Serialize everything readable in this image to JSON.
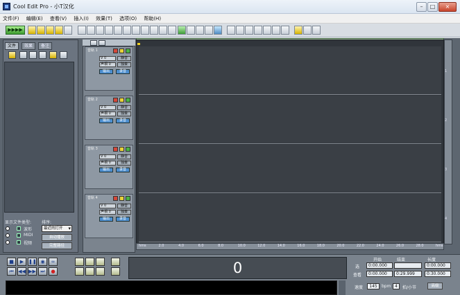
{
  "window": {
    "title": "Cool Edit Pro  - 小T汉化",
    "min": "–",
    "max": "□",
    "close": "×"
  },
  "menu": [
    "文件(F)",
    "编辑(E)",
    "查看(V)",
    "插入(I)",
    "效果(T)",
    "选项(O)",
    "帮助(H)"
  ],
  "toolbar": {
    "mode_label": "▶▶▶▶"
  },
  "left_panel": {
    "tabs": [
      "文件",
      "效果",
      "备注"
    ],
    "show_type_label": "显示文件类型:",
    "sort_label": "排序:",
    "types": [
      "波形",
      "MIDI",
      "视频"
    ],
    "sort_value": "最近的打开",
    "btn1": "自动播放",
    "btn2": "完整路径"
  },
  "tracks": [
    {
      "name": "音轨 1",
      "vol": "V 0",
      "pan": "声相 0",
      "b1": "静音",
      "b2": "独奏",
      "out": "输出",
      "rec": "录音"
    },
    {
      "name": "音轨 2",
      "vol": "V 0",
      "pan": "声相 0",
      "b1": "静音",
      "b2": "独奏",
      "out": "输出",
      "rec": "录音"
    },
    {
      "name": "音轨 3",
      "vol": "V 0",
      "pan": "声相 0",
      "b1": "静音",
      "b2": "独奏",
      "out": "输出",
      "rec": "录音"
    },
    {
      "name": "音轨 4",
      "vol": "V 0",
      "pan": "声相 0",
      "b1": "静音",
      "b2": "独奏",
      "out": "输出",
      "rec": "录音"
    }
  ],
  "lane_numbers": [
    "1",
    "2",
    "3",
    "4"
  ],
  "timeline": [
    "hms",
    "2.0",
    "4.0",
    "6.0",
    "8.0",
    "10.0",
    "12.0",
    "14.0",
    "16.0",
    "18.0",
    "20.0",
    "22.0",
    "24.0",
    "26.0",
    "28.0",
    "hms"
  ],
  "time_display": "0",
  "selection": {
    "col_start": "开始",
    "col_end": "结束",
    "col_len": "长度",
    "row_sel": "选",
    "row_view": "查看",
    "sel_start": "0:00.000",
    "sel_len": "0:00.000",
    "view_start": "0:00.000",
    "view_end": "0:29.999",
    "view_len": "0:30.000"
  },
  "tempo": {
    "label": "速度",
    "value": "145",
    "unit": "bpm",
    "beats": "4",
    "beats_unit": "拍/小节",
    "adv": "高级"
  }
}
